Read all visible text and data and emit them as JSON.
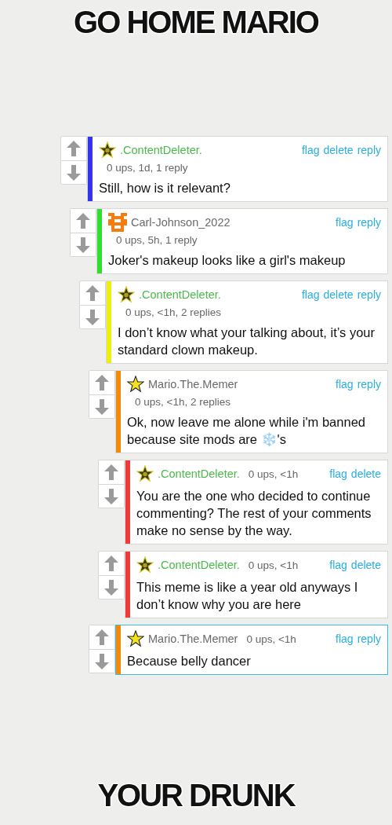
{
  "caption_top": "GO HOME MARIO",
  "comments": [
    {
      "avatar": {
        "kind": "badge-star"
      },
      "user": {
        "name": ".ContentDeleter.",
        "color": "#4cb84c"
      },
      "meta": {
        "kind": "below",
        "text": "0 ups, 1d, 1 reply"
      },
      "actions": [
        "flag",
        "delete",
        "reply"
      ],
      "text": "Still, how is it relevant?",
      "color": "#3434f0",
      "highlighted": false,
      "children": [
        {
          "avatar": {
            "kind": "pixel"
          },
          "user": {
            "name": "Carl-Johnson_2022",
            "color": "#6a6a6a"
          },
          "meta": {
            "kind": "below",
            "text": "0 ups, 5h, 1 reply"
          },
          "actions": [
            "flag",
            "reply"
          ],
          "text": "Joker's makeup looks like a girl's makeup",
          "color": "#2ee02e",
          "highlighted": false,
          "children": [
            {
              "avatar": {
                "kind": "badge-star"
              },
              "user": {
                "name": ".ContentDeleter.",
                "color": "#4cb84c"
              },
              "meta": {
                "kind": "below",
                "text": "0 ups, <1h, 2 replies"
              },
              "actions": [
                "flag",
                "delete",
                "reply"
              ],
              "text": "I don’t know what your talking about, it’s your standard clown makeup.",
              "color": "#eeee10",
              "highlighted": false,
              "children": [
                {
                  "avatar": {
                    "kind": "star"
                  },
                  "user": {
                    "name": "Mario.The.Memer",
                    "color": "#6a6a6a"
                  },
                  "meta": {
                    "kind": "below",
                    "text": "0 ups, <1h, 2 replies"
                  },
                  "actions": [
                    "flag",
                    "reply"
                  ],
                  "text": "Ok, now leave me alone while i'm banned because site mods are ❄️'s",
                  "color": "#f58a0a",
                  "highlighted": false,
                  "children": [
                    {
                      "avatar": {
                        "kind": "badge-star"
                      },
                      "user": {
                        "name": ".ContentDeleter.",
                        "color": "#4cb84c"
                      },
                      "meta": {
                        "kind": "inline",
                        "text": "0 ups, <1h"
                      },
                      "actions": [
                        "flag",
                        "delete"
                      ],
                      "text": "You are the one who decided to continue commenting? The rest of your comments make no sense by the way.",
                      "color": "#f03a3a",
                      "highlighted": false
                    },
                    {
                      "avatar": {
                        "kind": "badge-star"
                      },
                      "user": {
                        "name": ".ContentDeleter.",
                        "color": "#4cb84c"
                      },
                      "meta": {
                        "kind": "inline",
                        "text": "0 ups, <1h"
                      },
                      "actions": [
                        "flag",
                        "delete"
                      ],
                      "text": "This meme is like a year old anyways I don’t know why you are here",
                      "color": "#f03a3a",
                      "highlighted": false
                    }
                  ]
                },
                {
                  "avatar": {
                    "kind": "star"
                  },
                  "user": {
                    "name": "Mario.The.Memer",
                    "color": "#6a6a6a"
                  },
                  "meta": {
                    "kind": "inline",
                    "text": "0 ups, <1h"
                  },
                  "actions": [
                    "flag",
                    "reply"
                  ],
                  "text": "Because belly dancer",
                  "color": "#f58a0a",
                  "highlighted": true
                }
              ]
            }
          ]
        }
      ]
    }
  ],
  "caption_bottom": "YOUR DRUNK"
}
